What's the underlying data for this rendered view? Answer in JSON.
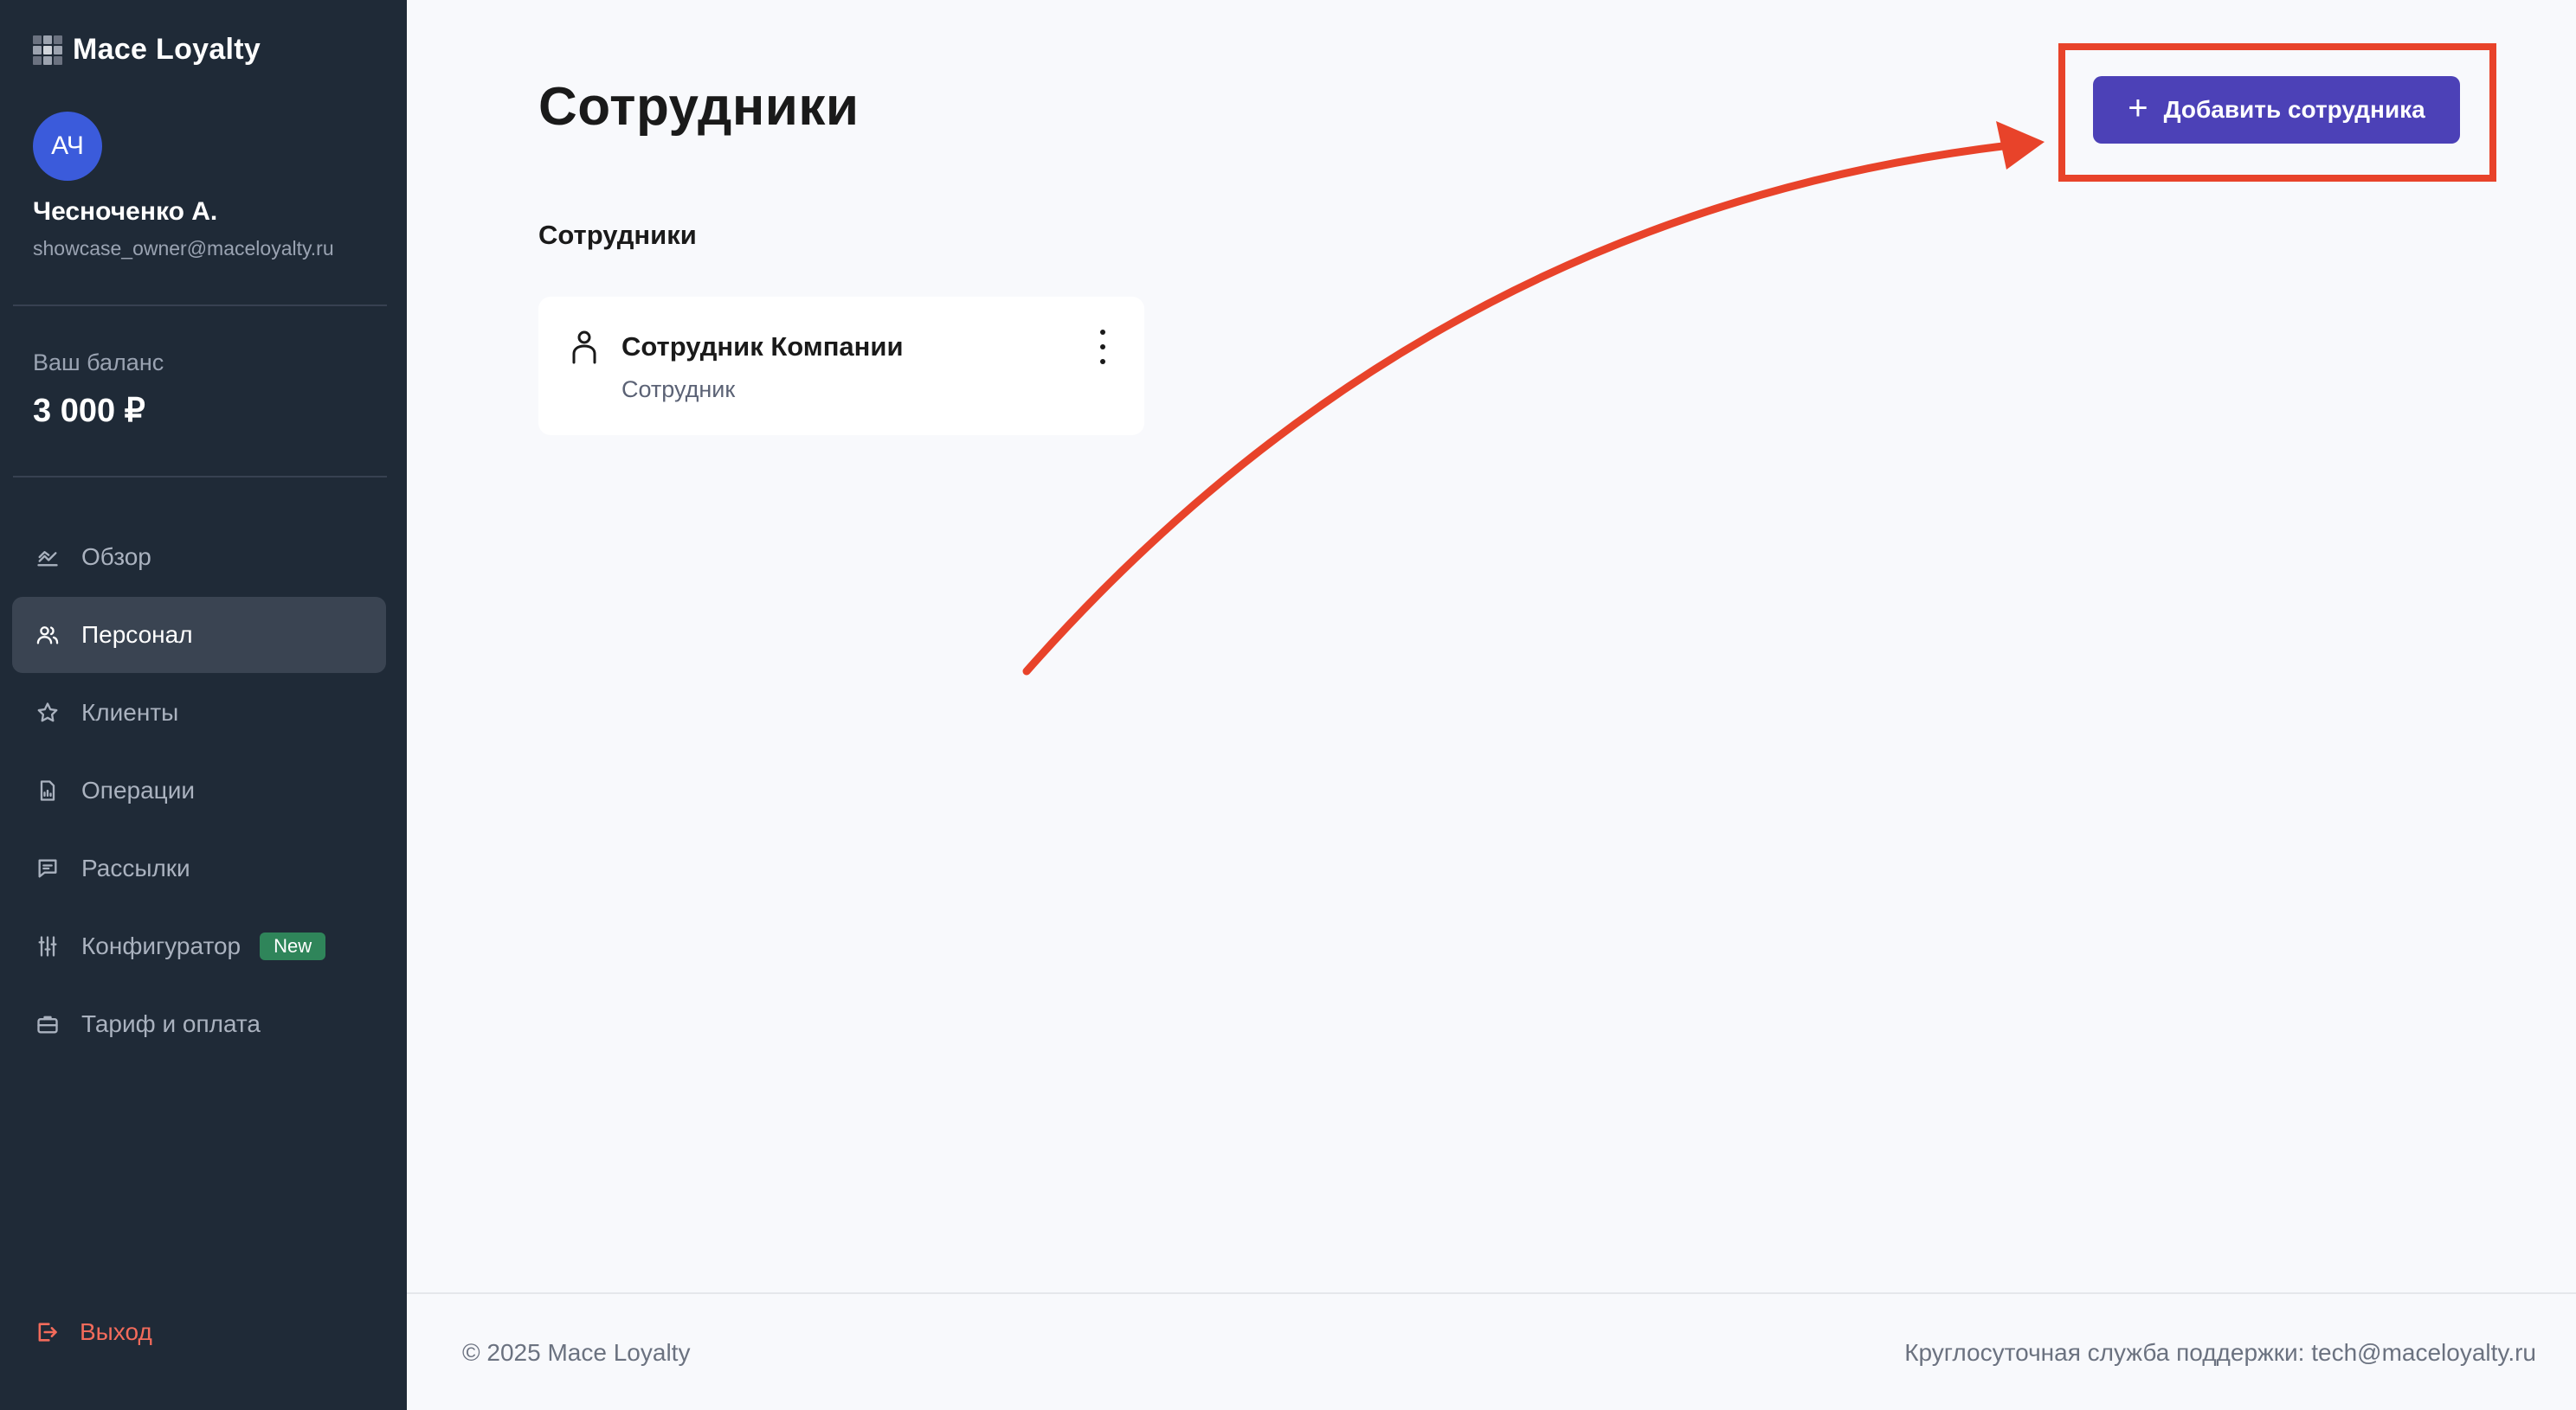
{
  "app": {
    "brand": "Mace Loyalty"
  },
  "user": {
    "initials": "АЧ",
    "name": "Чесноченко А.",
    "email": "showcase_owner@maceloyalty.ru"
  },
  "balance": {
    "label": "Ваш баланс",
    "value": "3 000 ₽"
  },
  "nav": {
    "items": [
      {
        "label": "Обзор",
        "icon": "chart-icon"
      },
      {
        "label": "Персонал",
        "icon": "users-icon",
        "active": true
      },
      {
        "label": "Клиенты",
        "icon": "star-icon"
      },
      {
        "label": "Операции",
        "icon": "document-icon"
      },
      {
        "label": "Рассылки",
        "icon": "message-icon"
      },
      {
        "label": "Конфигуратор",
        "icon": "sliders-icon",
        "badge": "New"
      },
      {
        "label": "Тариф и оплата",
        "icon": "briefcase-icon"
      }
    ],
    "logout": "Выход"
  },
  "main": {
    "title": "Сотрудники",
    "section_title": "Сотрудники",
    "add_button": "Добавить сотрудника",
    "employees": [
      {
        "name": "Сотрудник Компании",
        "role": "Сотрудник"
      }
    ]
  },
  "footer": {
    "copyright": "© 2025 Mace Loyalty",
    "support": "Круглосуточная служба поддержки: tech@maceloyalty.ru"
  },
  "colors": {
    "sidebar": "#1f2a37",
    "accent": "#4c41b7",
    "annotation": "#e8432a",
    "badge_new": "#2f855a",
    "logout": "#f36b5b"
  }
}
